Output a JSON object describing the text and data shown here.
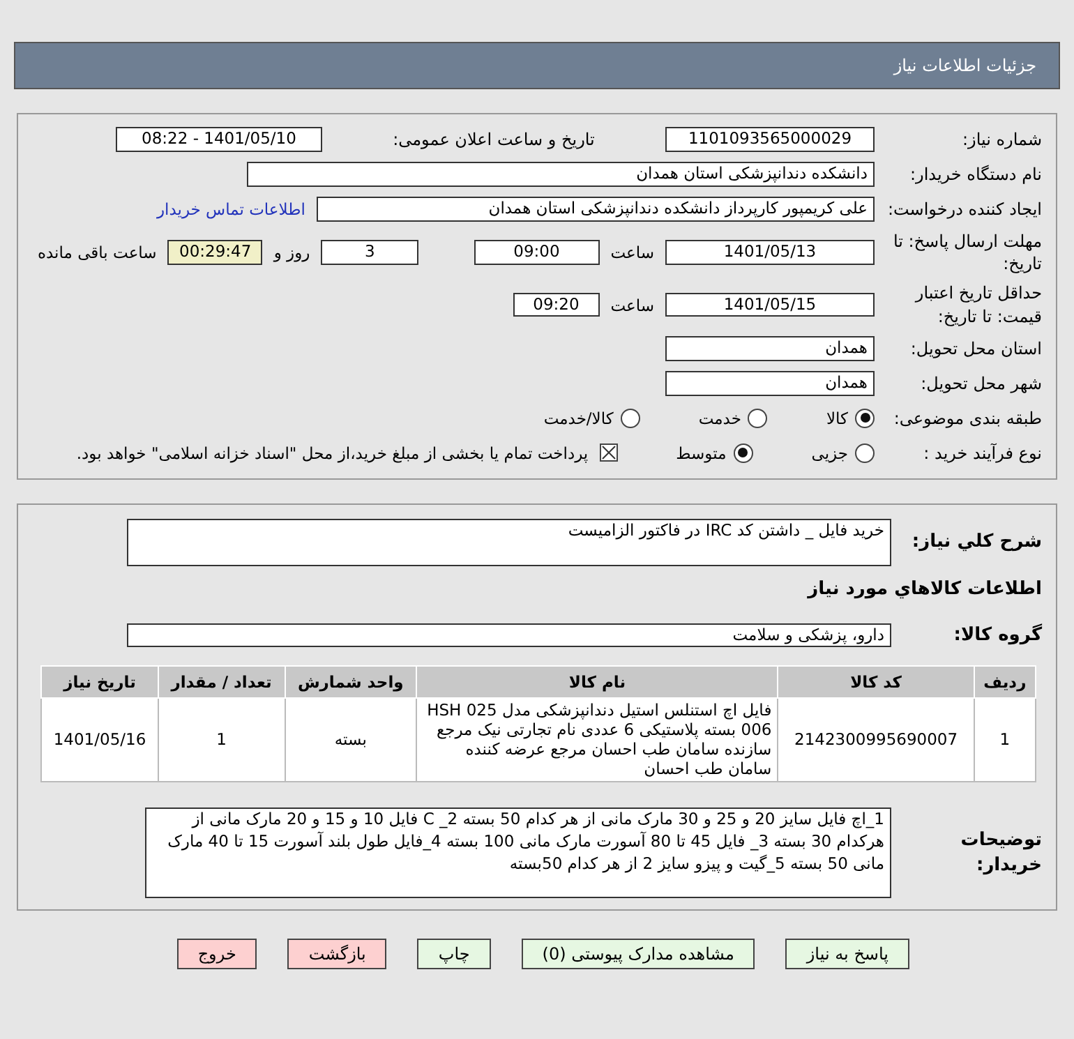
{
  "header": {
    "title": "جزئیات اطلاعات نیاز"
  },
  "need_number": {
    "label": "شماره نیاز:",
    "value": "1101093565000029"
  },
  "announce": {
    "label": "تاریخ و ساعت اعلان عمومی:",
    "value": "1401/05/10 - 08:22"
  },
  "buyer": {
    "label": "نام دستگاه خریدار:",
    "value": "دانشکده دندانپزشکی استان همدان"
  },
  "creator": {
    "label": "ایجاد کننده درخواست:",
    "value": "علی کریمپور کارپرداز دانشکده دندانپزشکی استان همدان",
    "link": "اطلاعات تماس خریدار"
  },
  "deadline": {
    "label": "مهلت ارسال پاسخ: تا تاریخ:",
    "date": "1401/05/13",
    "time_label": "ساعت",
    "time": "09:00",
    "days": "3",
    "days_label": "روز و",
    "remaining": "00:29:47",
    "remaining_label": "ساعت باقی مانده"
  },
  "validity": {
    "label": "حداقل تاریخ اعتبار قیمت: تا تاریخ:",
    "date": "1401/05/15",
    "time_label": "ساعت",
    "time": "09:20"
  },
  "province": {
    "label": "استان محل تحویل:",
    "value": "همدان"
  },
  "city": {
    "label": "شهر محل تحویل:",
    "value": "همدان"
  },
  "category": {
    "label": "طبقه بندی موضوعی:",
    "options": [
      {
        "label": "کالا",
        "selected": true
      },
      {
        "label": "خدمت",
        "selected": false
      },
      {
        "label": "کالا/خدمت",
        "selected": false
      }
    ]
  },
  "process": {
    "label": "نوع فرآیند خرید :",
    "options": [
      {
        "label": "جزیی",
        "selected": false
      },
      {
        "label": "متوسط",
        "selected": true
      }
    ],
    "payment_checked": true,
    "payment_text": "پرداخت تمام یا بخشی از مبلغ خرید،از محل \"اسناد خزانه اسلامی\" خواهد بود."
  },
  "description": {
    "label": "شرح کلي نياز:",
    "value": "خرید فایل   _   داشتن کد IRC در فاکتور الزامیست"
  },
  "goods_title": "اطلاعات کالاهاي مورد نياز",
  "goods_group": {
    "label": "گروه کالا:",
    "value": "دارو، پزشکی و سلامت"
  },
  "table": {
    "columns": [
      "ردیف",
      "کد کالا",
      "نام کالا",
      "واحد شمارش",
      "تعداد / مقدار",
      "تاریخ نیاز"
    ],
    "rows": [
      [
        "1",
        "2142300995690007",
        "فایل اچ استنلس استیل دندانپزشکی مدل HSH 025 006 بسته پلاستیکی 6 عددی نام تجارتی نیک مرجع سازنده سامان طب احسان مرجع عرضه کننده سامان طب احسان",
        "بسته",
        "1",
        "1401/05/16"
      ]
    ]
  },
  "buyer_notes": {
    "label": "توضیحات خریدار:",
    "value": "1_اچ فایل سایز 20 و 25 و 30 مارک مانی از هر کدام 50 بسته   2_ C فایل 10 و 15 و 20 مارک مانی از هرکدام 30 بسته   3_ فایل 45 تا 80 آسورت مارک مانی 100 بسته   4_فایل طول بلند آسورت 15 تا 40 مارک مانی 50 بسته   5_گیت و پیزو سایز 2 از هر کدام 50بسته"
  },
  "buttons": [
    {
      "label": "پاسخ به نیاز",
      "kind": "green"
    },
    {
      "label": "مشاهده مدارک پیوستی (0)",
      "kind": "green"
    },
    {
      "label": "چاپ",
      "kind": "green"
    },
    {
      "label": "بازگشت",
      "kind": "red"
    },
    {
      "label": "خروج",
      "kind": "red"
    }
  ]
}
